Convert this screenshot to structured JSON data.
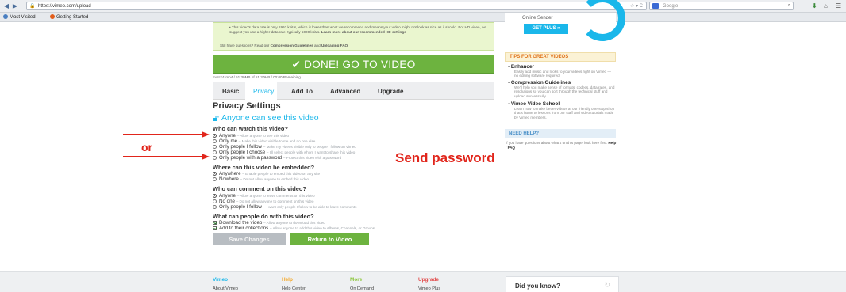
{
  "browser": {
    "url": "https://vimeo.com/upload",
    "search_placeholder": "Google",
    "bookmarks": [
      "Most Visited",
      "Getting Started"
    ]
  },
  "notice": {
    "text_plain_1": "This video's data rate is only 1993 kbit/s, which is lower than what we recommend and means your video might not look as nice as it should. For HD video, we suggest you use a higher data rate, typically 5000 kbit/s.",
    "text_link_1": "Learn more about our recommended HD settings",
    "question_prefix": "Still have questions? Read our",
    "question_link_1": "Compression Guidelines",
    "question_mid": "and",
    "question_link_2": "Uploading FAQ"
  },
  "done_button": "DONE! GO TO VIDEO",
  "file_status": "match1.mp4 / 51.30MB of 51.30MB / 00:00 Remaining",
  "tabs": [
    "Basic",
    "Privacy",
    "Add To",
    "Advanced",
    "Upgrade"
  ],
  "active_tab": "Privacy",
  "privacy": {
    "title": "Privacy Settings",
    "current": "Anyone can see this video",
    "who_watch": {
      "title": "Who can watch this video?",
      "options": [
        {
          "label": "Anyone",
          "desc": "– Allow anyone to see this video",
          "selected": true
        },
        {
          "label": "Only me",
          "desc": "– Make this video visible to me and no one else",
          "selected": false
        },
        {
          "label": "Only people I follow",
          "desc": "– Make my videos visible only to people I follow on Vimeo",
          "selected": false
        },
        {
          "label": "Only people I choose",
          "desc": "– I'll select people with whom I want to share this video",
          "selected": false
        },
        {
          "label": "Only people with a password",
          "desc": "– Protect this video with a password",
          "selected": false
        }
      ]
    },
    "embed": {
      "title": "Where can this video be embedded?",
      "options": [
        {
          "label": "Anywhere",
          "desc": "– Enable people to embed this video on any site",
          "selected": true
        },
        {
          "label": "Nowhere",
          "desc": "– Do not allow anyone to embed this video",
          "selected": false
        }
      ]
    },
    "comment": {
      "title": "Who can comment on this video?",
      "options": [
        {
          "label": "Anyone",
          "desc": "– Allow anyone to leave comments on this video",
          "selected": true
        },
        {
          "label": "No one",
          "desc": "– Do not allow anyone to comment on this video",
          "selected": false
        },
        {
          "label": "Only people I follow",
          "desc": "– I want only people I follow to be able to leave comments",
          "selected": false
        }
      ]
    },
    "actions": {
      "title": "What can people do with this video?",
      "options": [
        {
          "label": "Download the video",
          "desc": "– Allow anyone to download this video",
          "checked": true
        },
        {
          "label": "Add to their collections",
          "desc": "– Allow anyone to add this video to Albums, Channels, or Groups",
          "checked": true
        }
      ]
    },
    "save_button": "Save Changes",
    "return_button": "Return to Video"
  },
  "sidebar": {
    "plus_label": "Online Sender",
    "plus_button": "GET PLUS »",
    "tips_title": "TIPS FOR GREAT VIDEOS",
    "tips": [
      {
        "title": "Enhancer",
        "desc": "Easily add music and looks to your videos right on Vimeo — no editing software required."
      },
      {
        "title": "Compression Guidelines",
        "desc": "We'll help you make sense of formats, codecs, data rates, and resolutions so you can sort through the technical stuff and upload successfully."
      },
      {
        "title": "Vimeo Video School",
        "desc": "Learn how to make better videos at our friendly one-stop shop that's home to lessons from our staff and video tutorials made by Vimeo members."
      }
    ],
    "help_title": "NEED HELP?",
    "help_text": "If you have questions about what's on this page, look here first:",
    "help_link_1": "Help",
    "help_sep": "/",
    "help_link_2": "FAQ"
  },
  "annotations": {
    "or": "or",
    "send": "Send password"
  },
  "footer": {
    "columns": [
      {
        "heading": "Vimeo",
        "link": "About Vimeo",
        "color": "#1ab7ea"
      },
      {
        "heading": "Help",
        "link": "Help Center",
        "color": "#f5a623"
      },
      {
        "heading": "More",
        "link": "On Demand",
        "color": "#8dc63f"
      },
      {
        "heading": "Upgrade",
        "link": "Vimeo Plus",
        "color": "#e24c4c"
      }
    ],
    "did_you_know": "Did you know?"
  },
  "colors": {
    "accent": "#1ab7ea",
    "green": "#6db33f",
    "annotation": "#e1251b"
  }
}
